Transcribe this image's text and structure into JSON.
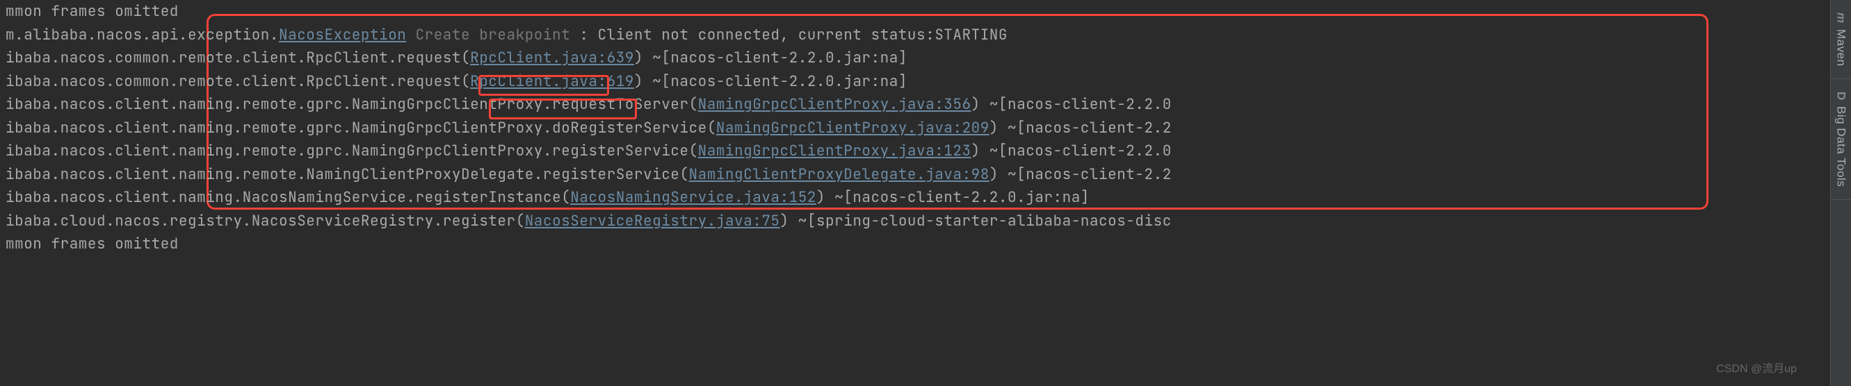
{
  "lines": [
    {
      "prefix": "mmon frames omitted",
      "parts": []
    },
    {
      "prefix": "m.alibaba.nacos.api.exception.",
      "parts": [
        {
          "type": "link",
          "text": "NacosException"
        },
        {
          "type": "breakpoint",
          "text": " Create breakpoint "
        },
        {
          "type": "plain",
          "text": ": Client not connected, current status:STARTING"
        }
      ]
    },
    {
      "prefix": "ibaba.nacos.common.remote.client.RpcClient.request(",
      "parts": [
        {
          "type": "link",
          "text": "RpcClient.java:639"
        },
        {
          "type": "plain",
          "text": ") ~[nacos-client-2.2.0.jar:na]"
        }
      ]
    },
    {
      "prefix": "ibaba.nacos.common.remote.client.RpcClient.request(",
      "parts": [
        {
          "type": "link",
          "text": "RpcClient.java:619"
        },
        {
          "type": "plain",
          "text": ") ~[nacos-client-2.2.0.jar:na]"
        }
      ]
    },
    {
      "prefix": "ibaba.nacos.client.naming.remote.gprc.NamingGrpcClientProxy.requestToServer(",
      "parts": [
        {
          "type": "link",
          "text": "NamingGrpcClientProxy.java:356"
        },
        {
          "type": "plain",
          "text": ") ~[nacos-client-2.2.0"
        }
      ]
    },
    {
      "prefix": "ibaba.nacos.client.naming.remote.gprc.NamingGrpcClientProxy.doRegisterService(",
      "parts": [
        {
          "type": "link",
          "text": "NamingGrpcClientProxy.java:209"
        },
        {
          "type": "plain",
          "text": ") ~[nacos-client-2.2"
        }
      ]
    },
    {
      "prefix": "ibaba.nacos.client.naming.remote.gprc.NamingGrpcClientProxy.registerService(",
      "parts": [
        {
          "type": "link",
          "text": "NamingGrpcClientProxy.java:123"
        },
        {
          "type": "plain",
          "text": ") ~[nacos-client-2.2.0"
        }
      ]
    },
    {
      "prefix": "ibaba.nacos.client.naming.remote.NamingClientProxyDelegate.registerService(",
      "parts": [
        {
          "type": "link",
          "text": "NamingClientProxyDelegate.java:98"
        },
        {
          "type": "plain",
          "text": ") ~[nacos-client-2.2"
        }
      ]
    },
    {
      "prefix": "ibaba.nacos.client.naming.NacosNamingService.registerInstance(",
      "parts": [
        {
          "type": "link",
          "text": "NacosNamingService.java:152"
        },
        {
          "type": "plain",
          "text": ") ~[nacos-client-2.2.0.jar:na]"
        }
      ]
    },
    {
      "prefix": "ibaba.cloud.nacos.registry.NacosServiceRegistry.register(",
      "parts": [
        {
          "type": "link",
          "text": "NacosServiceRegistry.java:75"
        },
        {
          "type": "plain",
          "text": ") ~[spring-cloud-starter-alibaba-nacos-disc"
        }
      ]
    },
    {
      "prefix": "mmon frames omitted",
      "parts": []
    }
  ],
  "sidebar": {
    "maven": {
      "icon": "m",
      "label": "Maven"
    },
    "bigdata": {
      "icon": "D",
      "label": "Big Data Tools"
    }
  },
  "watermark": "CSDN @流月up",
  "highlights": {
    "main_box": true,
    "method1": "requestToServer",
    "method2": "doRegisterService"
  }
}
